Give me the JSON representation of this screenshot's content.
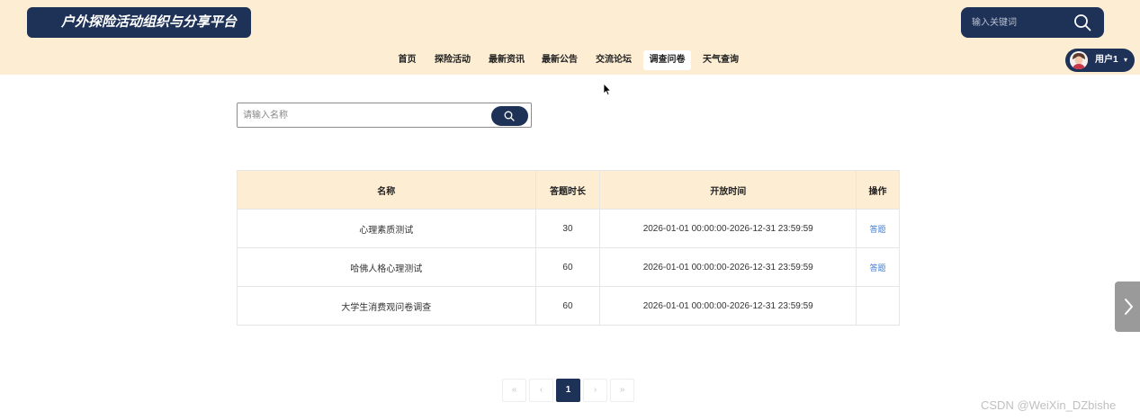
{
  "header": {
    "title": "户外探险活动组织与分享平台",
    "search_placeholder": "输入关键词",
    "nav": [
      "首页",
      "探险活动",
      "最新资讯",
      "最新公告",
      "交流论坛",
      "调查问卷",
      "天气查询"
    ],
    "active_nav": "调查问卷",
    "user": {
      "name": "用户1",
      "caret": "▾"
    }
  },
  "filter": {
    "placeholder": "请输入名称"
  },
  "table": {
    "columns": [
      "名称",
      "答题时长",
      "开放时间",
      "操作"
    ],
    "rows": [
      {
        "name": "心理素质测试",
        "duration": "30",
        "time": "2026-01-01 00:00:00-2026-12-31 23:59:59",
        "action": "答题"
      },
      {
        "name": "哈佛人格心理测试",
        "duration": "60",
        "time": "2026-01-01 00:00:00-2026-12-31 23:59:59",
        "action": "答题"
      },
      {
        "name": "大学生消费观问卷调查",
        "duration": "60",
        "time": "2026-01-01 00:00:00-2026-12-31 23:59:59",
        "action": ""
      }
    ]
  },
  "pagination": {
    "first": "«",
    "prev": "‹",
    "current": "1",
    "next": "›",
    "last": "»"
  },
  "watermark": "CSDN @WeiXin_DZbishe",
  "colors": {
    "navy": "#1e3157",
    "cream": "#fcedd3",
    "link": "#3e7bd4"
  }
}
